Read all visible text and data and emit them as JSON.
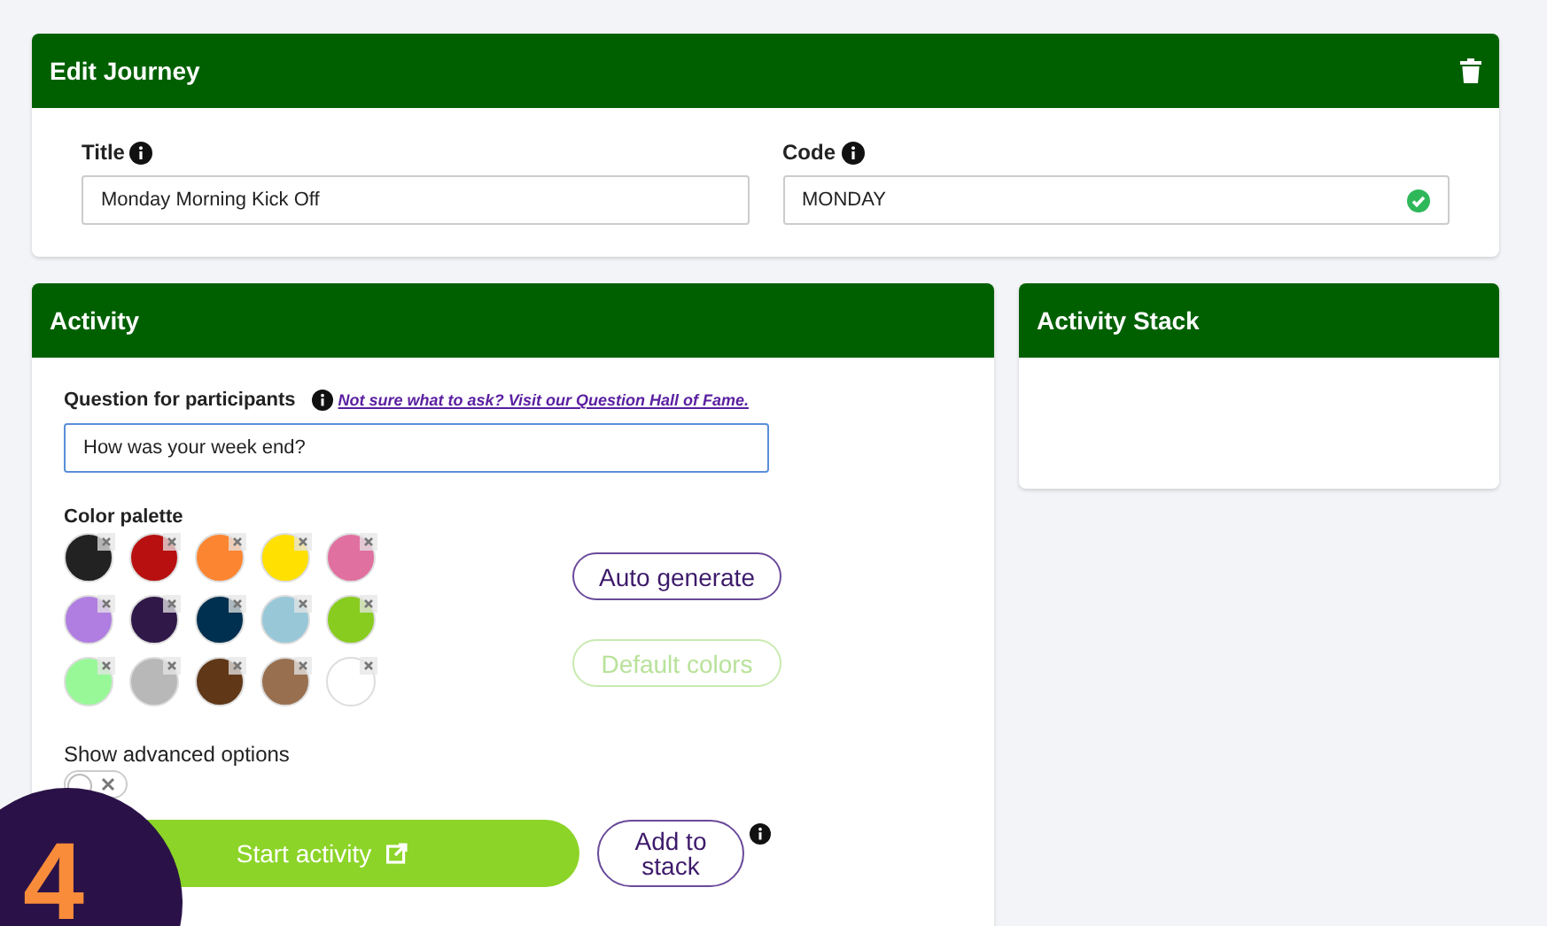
{
  "edit_journey": {
    "title": "Edit Journey",
    "fields": [
      {
        "label": "Title",
        "value": "Monday Morning Kick Off",
        "valid": false
      },
      {
        "label": "Code",
        "value": "MONDAY",
        "valid": true
      }
    ]
  },
  "activity": {
    "title": "Activity",
    "question_label": "Question for participants",
    "hall_of_fame_link": "Not sure what to ask? Visit our Question Hall of Fame.",
    "question_value": "How was your week end?",
    "palette_label": "Color palette",
    "palette": [
      {
        "color": "#222222"
      },
      {
        "color": "#b81010"
      },
      {
        "color": "#fb8530"
      },
      {
        "color": "#ffe000"
      },
      {
        "color": "#e070a0"
      },
      {
        "color": "#b07ee0"
      },
      {
        "color": "#301848"
      },
      {
        "color": "#003050"
      },
      {
        "color": "#98c8d8"
      },
      {
        "color": "#88cc20"
      },
      {
        "color": "#98f898"
      },
      {
        "color": "#b8b8b8"
      },
      {
        "color": "#603818"
      },
      {
        "color": "#987050"
      },
      {
        "color": "#ffffff"
      }
    ],
    "palette_buttons": [
      {
        "label": "Auto generate",
        "disabled": false
      },
      {
        "label": "Default colors",
        "disabled": true
      }
    ],
    "advanced_options": {
      "label": "Show advanced options",
      "on": false
    },
    "start_button": "Start activity",
    "stack_button": "Add to stack"
  },
  "activity_stack": {
    "title": "Activity Stack"
  },
  "step_badge": "4"
}
